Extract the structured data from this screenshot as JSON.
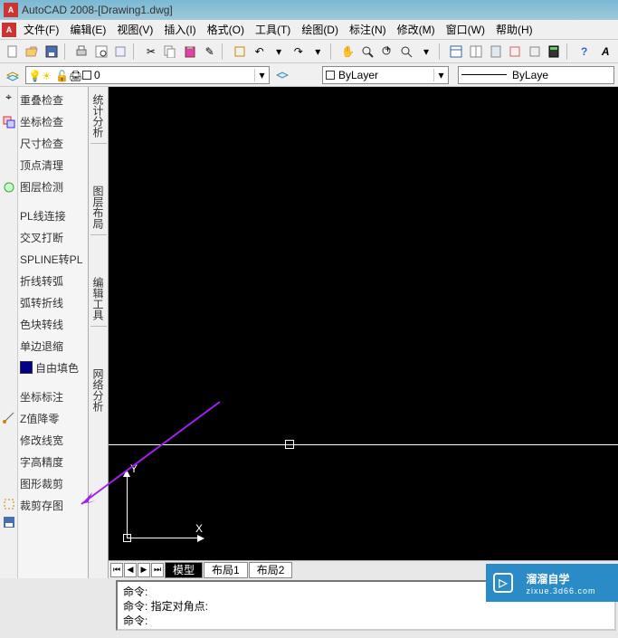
{
  "titlebar": {
    "app": "AutoCAD 2008",
    "sep": " - ",
    "doc": "[Drawing1.dwg]"
  },
  "menubar": {
    "items": [
      "文件(F)",
      "编辑(E)",
      "视图(V)",
      "插入(I)",
      "格式(O)",
      "工具(T)",
      "绘图(D)",
      "标注(N)",
      "修改(M)",
      "窗口(W)",
      "帮助(H)"
    ]
  },
  "layer": {
    "current_value": "0",
    "bylayer": "ByLayer",
    "linetype": "ByLaye"
  },
  "left_tools": {
    "items": [
      {
        "label": "重叠检查",
        "icon": true
      },
      {
        "label": "坐标检查",
        "icon": false
      },
      {
        "label": "尺寸检查",
        "icon": false
      },
      {
        "label": "顶点清理",
        "icon": true
      },
      {
        "label": "图层检测",
        "icon": false
      },
      {
        "label": "PL线连接",
        "icon": false
      },
      {
        "label": "交叉打断",
        "icon": false
      },
      {
        "label": "SPLINE转PL",
        "icon": false
      },
      {
        "label": "折线转弧",
        "icon": false
      },
      {
        "label": "弧转折线",
        "icon": false
      },
      {
        "label": "色块转线",
        "icon": false
      },
      {
        "label": "单边退缩",
        "icon": false
      },
      {
        "label": "自由填色",
        "swatch": true
      },
      {
        "label": "坐标标注",
        "icon": true
      },
      {
        "label": "Z值降零",
        "icon": false
      },
      {
        "label": "修改线宽",
        "icon": false
      },
      {
        "label": "字高精度",
        "icon": false
      },
      {
        "label": "图形裁剪",
        "icon": true
      },
      {
        "label": "裁剪存图",
        "icon": true
      }
    ]
  },
  "vert_strip": {
    "groups": [
      "统计分析",
      "图层布局",
      "编辑工具",
      "网络分析"
    ]
  },
  "canvas": {
    "y_label": "Y",
    "x_label": "X"
  },
  "tabs": {
    "items": [
      {
        "label": "模型",
        "active": true
      },
      {
        "label": "布局1",
        "active": false
      },
      {
        "label": "布局2",
        "active": false
      }
    ]
  },
  "command": {
    "lines": [
      "命令:",
      "命令:  指定对角点:",
      "命令:"
    ]
  },
  "watermark": {
    "text": "溜溜自学",
    "sub": "zixue.3d66.com"
  }
}
